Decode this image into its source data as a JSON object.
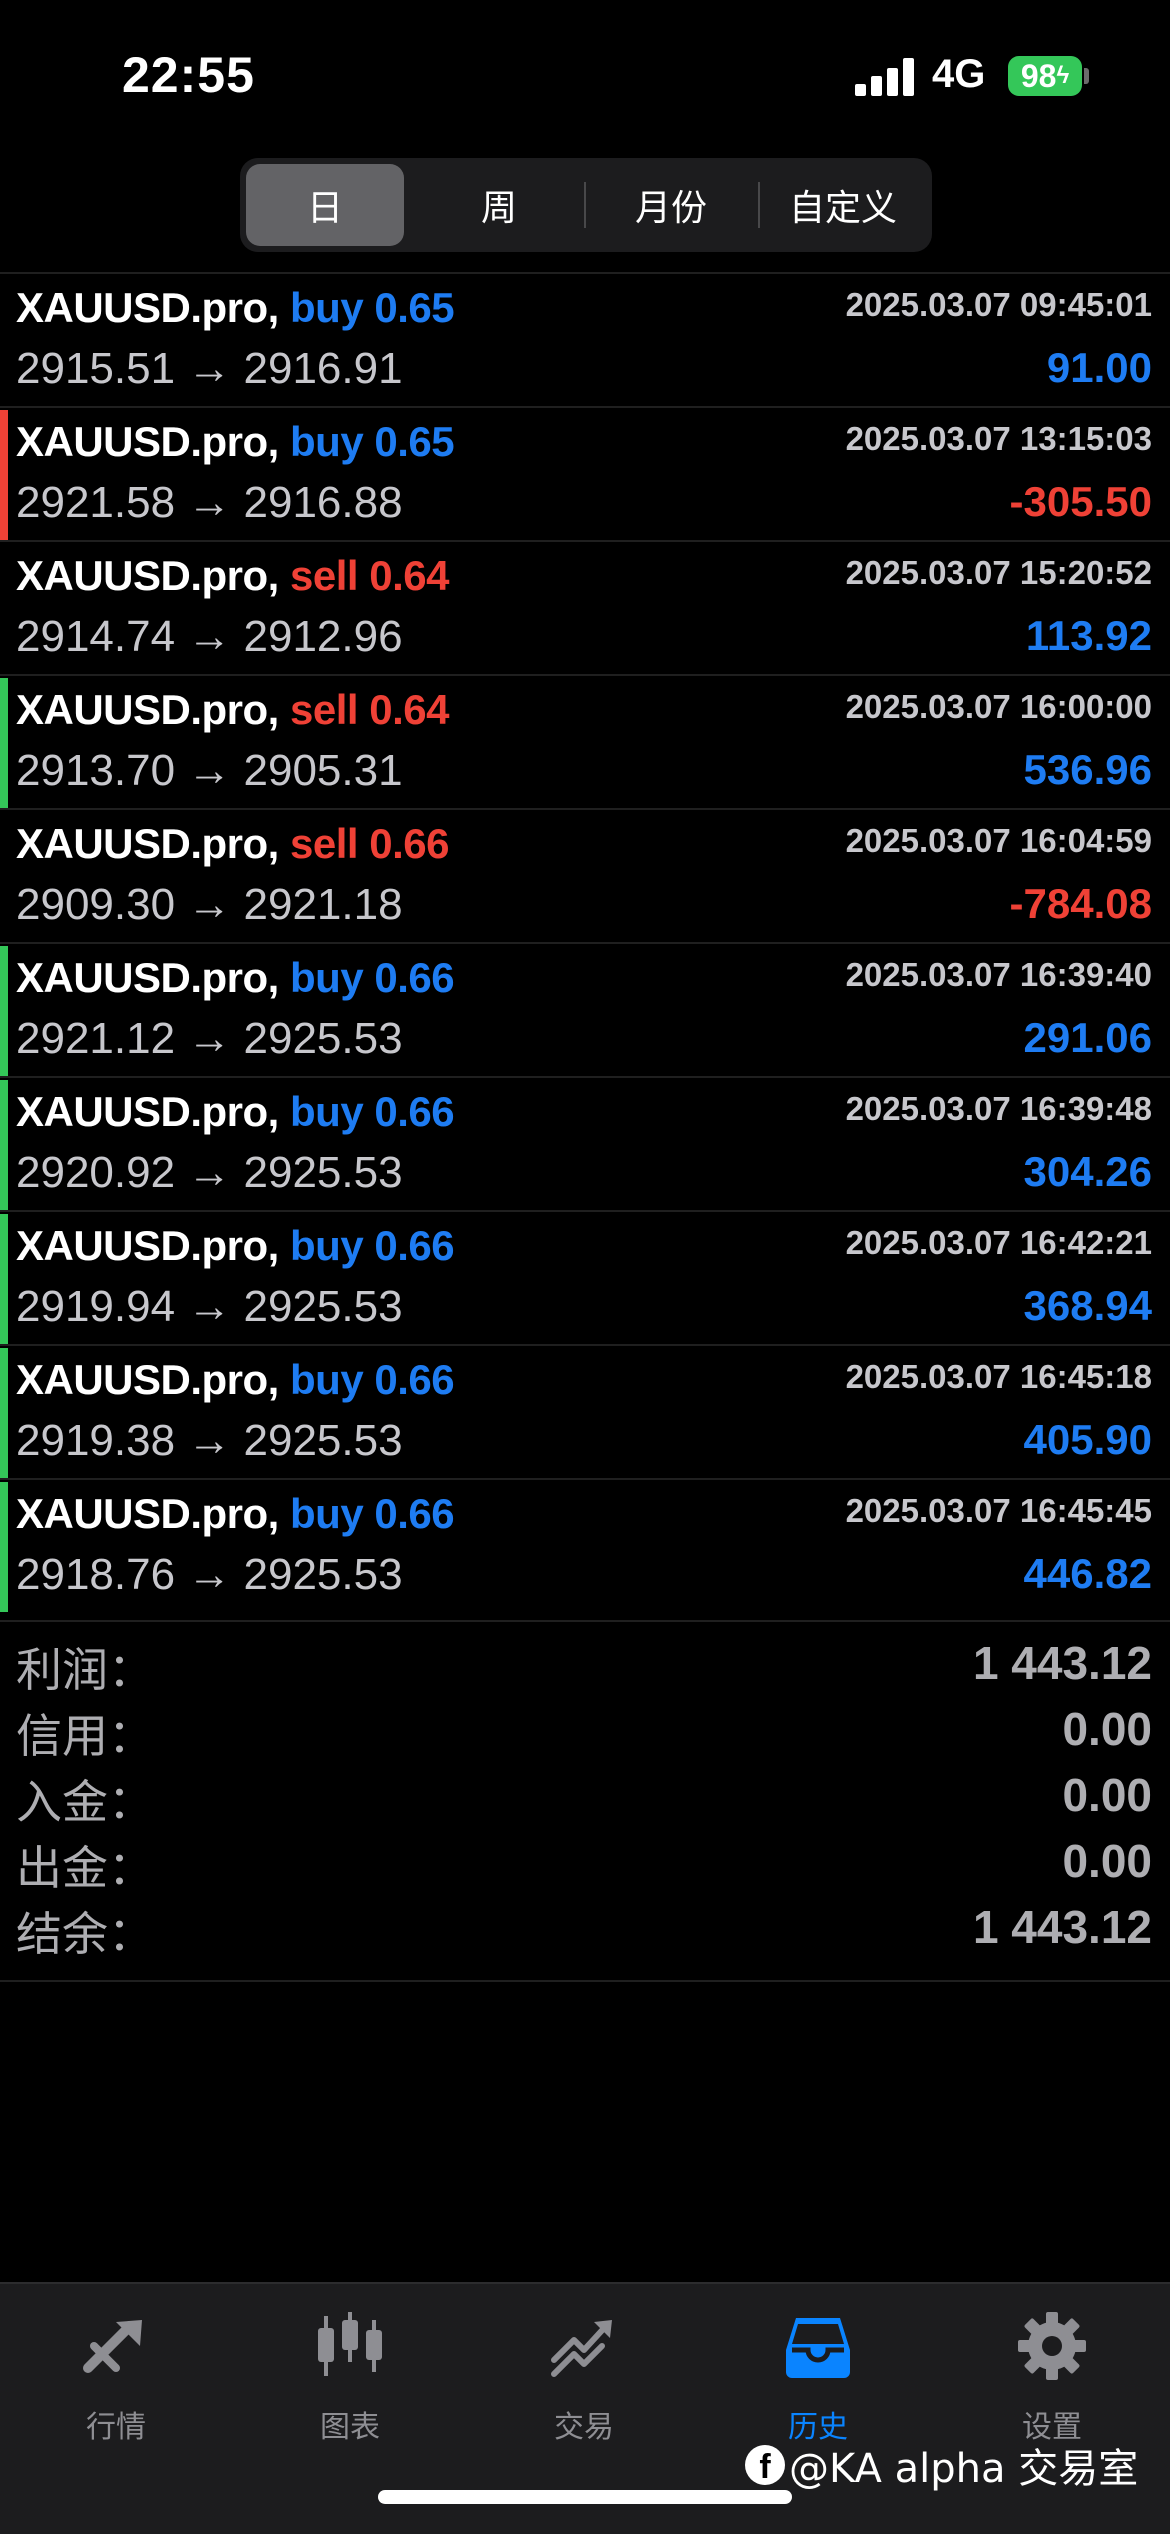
{
  "status_bar": {
    "time": "22:55",
    "network": "4G",
    "battery": "98"
  },
  "period_tabs": [
    {
      "label": "日",
      "active": true
    },
    {
      "label": "周",
      "active": false
    },
    {
      "label": "月份",
      "active": false
    },
    {
      "label": "自定义",
      "active": false
    }
  ],
  "deals": [
    {
      "symbol": "XAUUSD.pro,",
      "side": "buy 0.65",
      "side_type": "buy",
      "time": "2025.03.07 09:45:01",
      "prices": "2915.51 → 2916.91",
      "profit": "91.00",
      "profit_sign": "pos",
      "marker": "none"
    },
    {
      "symbol": "XAUUSD.pro,",
      "side": "buy 0.65",
      "side_type": "buy",
      "time": "2025.03.07 13:15:03",
      "prices": "2921.58 → 2916.88",
      "profit": "-305.50",
      "profit_sign": "neg",
      "marker": "red"
    },
    {
      "symbol": "XAUUSD.pro,",
      "side": "sell 0.64",
      "side_type": "sell",
      "time": "2025.03.07 15:20:52",
      "prices": "2914.74 → 2912.96",
      "profit": "113.92",
      "profit_sign": "pos",
      "marker": "none"
    },
    {
      "symbol": "XAUUSD.pro,",
      "side": "sell 0.64",
      "side_type": "sell",
      "time": "2025.03.07 16:00:00",
      "prices": "2913.70 → 2905.31",
      "profit": "536.96",
      "profit_sign": "pos",
      "marker": "green"
    },
    {
      "symbol": "XAUUSD.pro,",
      "side": "sell 0.66",
      "side_type": "sell",
      "time": "2025.03.07 16:04:59",
      "prices": "2909.30 → 2921.18",
      "profit": "-784.08",
      "profit_sign": "neg",
      "marker": "none"
    },
    {
      "symbol": "XAUUSD.pro,",
      "side": "buy 0.66",
      "side_type": "buy",
      "time": "2025.03.07 16:39:40",
      "prices": "2921.12 → 2925.53",
      "profit": "291.06",
      "profit_sign": "pos",
      "marker": "green"
    },
    {
      "symbol": "XAUUSD.pro,",
      "side": "buy 0.66",
      "side_type": "buy",
      "time": "2025.03.07 16:39:48",
      "prices": "2920.92 → 2925.53",
      "profit": "304.26",
      "profit_sign": "pos",
      "marker": "green"
    },
    {
      "symbol": "XAUUSD.pro,",
      "side": "buy 0.66",
      "side_type": "buy",
      "time": "2025.03.07 16:42:21",
      "prices": "2919.94 → 2925.53",
      "profit": "368.94",
      "profit_sign": "pos",
      "marker": "green"
    },
    {
      "symbol": "XAUUSD.pro,",
      "side": "buy 0.66",
      "side_type": "buy",
      "time": "2025.03.07 16:45:18",
      "prices": "2919.38 → 2925.53",
      "profit": "405.90",
      "profit_sign": "pos",
      "marker": "green"
    },
    {
      "symbol": "XAUUSD.pro,",
      "side": "buy 0.66",
      "side_type": "buy",
      "time": "2025.03.07 16:45:45",
      "prices": "2918.76 → 2925.53",
      "profit": "446.82",
      "profit_sign": "pos",
      "marker": "green"
    }
  ],
  "summary": [
    {
      "label": "利润：",
      "value": "1 443.12"
    },
    {
      "label": "信用：",
      "value": "0.00"
    },
    {
      "label": "入金：",
      "value": "0.00"
    },
    {
      "label": "出金：",
      "value": "0.00"
    },
    {
      "label": "结余：",
      "value": "1 443.12"
    }
  ],
  "tab_bar": [
    {
      "label": "行情",
      "icon": "quotes-icon",
      "active": false
    },
    {
      "label": "图表",
      "icon": "chart-icon",
      "active": false
    },
    {
      "label": "交易",
      "icon": "trade-icon",
      "active": false
    },
    {
      "label": "历史",
      "icon": "history-icon",
      "active": true
    },
    {
      "label": "设置",
      "icon": "settings-icon",
      "active": false
    }
  ],
  "watermark": "@KA  alpha 交易室",
  "colors": {
    "buy": "#1e7cf2",
    "sell": "#ef4136",
    "profit": "#1e7cf2",
    "loss": "#ef4136",
    "marker_green": "#34c759",
    "marker_red": "#ef4136",
    "active_tab": "#0a84ff"
  }
}
